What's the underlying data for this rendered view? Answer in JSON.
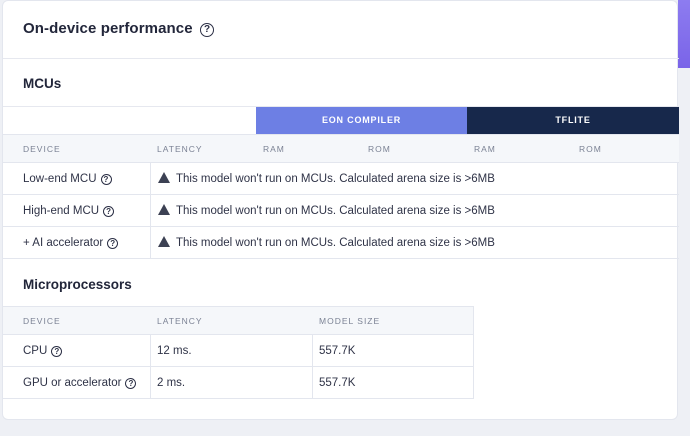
{
  "header": {
    "title": "On-device performance"
  },
  "mcu": {
    "title": "MCUs",
    "bands": {
      "eon": "EON COMPILER",
      "tflite": "TFLITE"
    },
    "columns": {
      "device": "DEVICE",
      "latency": "LATENCY",
      "ram1": "RAM",
      "rom1": "ROM",
      "ram2": "RAM",
      "rom2": "ROM"
    },
    "rows": [
      {
        "device": "Low-end MCU",
        "message": "This model won't run on MCUs. Calculated arena size is >6MB"
      },
      {
        "device": "High-end MCU",
        "message": "This model won't run on MCUs. Calculated arena size is >6MB"
      },
      {
        "device": "+ AI accelerator",
        "message": "This model won't run on MCUs. Calculated arena size is >6MB"
      }
    ]
  },
  "mpu": {
    "title": "Microprocessors",
    "columns": {
      "device": "DEVICE",
      "latency": "LATENCY",
      "model_size": "MODEL SIZE"
    },
    "rows": [
      {
        "device": "CPU",
        "latency": "12 ms.",
        "model_size": "557.7K"
      },
      {
        "device": "GPU or accelerator",
        "latency": "2 ms.",
        "model_size": "557.7K"
      }
    ]
  },
  "colors": {
    "eon_band": "#6d7fe4",
    "tflite_band": "#17284b",
    "accent": "#7a64e8"
  },
  "icons": {
    "help": "question-circle-icon",
    "warning": "warning-triangle-icon"
  }
}
